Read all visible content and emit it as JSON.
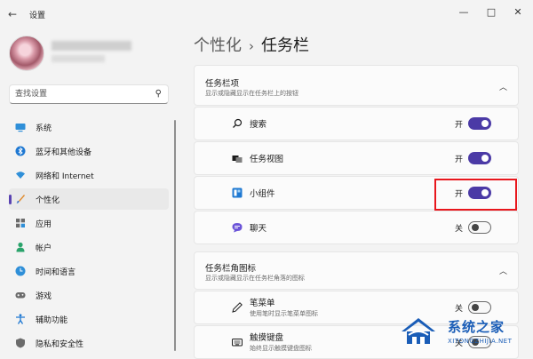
{
  "window": {
    "title": "设置",
    "back": "←",
    "minimize": "—",
    "maximize": "□",
    "close": "✕"
  },
  "search": {
    "placeholder": "查找设置"
  },
  "sidebar": {
    "items": [
      {
        "label": "系统",
        "icon": "monitor-icon"
      },
      {
        "label": "蓝牙和其他设备",
        "icon": "bluetooth-icon"
      },
      {
        "label": "网络和 Internet",
        "icon": "wifi-icon"
      },
      {
        "label": "个性化",
        "icon": "brush-icon",
        "active": true
      },
      {
        "label": "应用",
        "icon": "apps-icon"
      },
      {
        "label": "帐户",
        "icon": "account-icon"
      },
      {
        "label": "时间和语言",
        "icon": "globe-clock-icon"
      },
      {
        "label": "游戏",
        "icon": "gamepad-icon"
      },
      {
        "label": "辅助功能",
        "icon": "accessibility-icon"
      },
      {
        "label": "隐私和安全性",
        "icon": "shield-icon"
      }
    ]
  },
  "breadcrumb": {
    "parent": "个性化",
    "separator": "›",
    "current": "任务栏"
  },
  "taskbar_items": {
    "title": "任务栏项",
    "subtitle": "显示或隐藏显示在任务栏上的按钮",
    "rows": [
      {
        "label": "搜索",
        "state": "开",
        "on": true,
        "icon": "search-icon"
      },
      {
        "label": "任务视图",
        "state": "开",
        "on": true,
        "icon": "task-view-icon"
      },
      {
        "label": "小组件",
        "state": "开",
        "on": true,
        "icon": "widgets-icon"
      },
      {
        "label": "聊天",
        "state": "关",
        "on": false,
        "icon": "chat-icon"
      }
    ]
  },
  "corner_icons": {
    "title": "任务栏角图标",
    "subtitle": "显示或隐藏显示在任务栏角落的图标",
    "rows": [
      {
        "label": "笔菜单",
        "desc": "使用笔时显示笔菜单图标",
        "state": "关",
        "on": false,
        "icon": "pen-icon"
      },
      {
        "label": "触摸键盘",
        "desc": "始终显示触摸键盘图标",
        "state": "关",
        "on": false,
        "icon": "keyboard-icon"
      }
    ]
  },
  "watermark": {
    "text": "系统之家",
    "url": "XITONGZHIJIA.NET"
  },
  "colors": {
    "accent": "#4b3aa6",
    "highlight": "#e8171d"
  }
}
